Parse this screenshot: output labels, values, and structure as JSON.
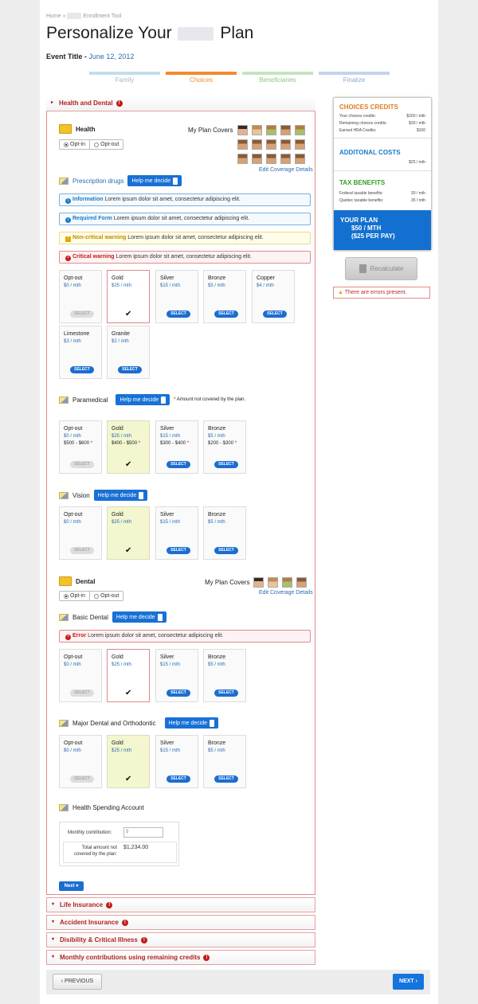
{
  "breadcrumb": {
    "home": "Home",
    "current": "Enrollment Tool"
  },
  "page_title": {
    "before": "Personalize Your",
    "after": "Plan"
  },
  "event": {
    "label": "Event Title",
    "date": "June 12, 2012"
  },
  "steps": [
    {
      "label": "Family",
      "color": "#c3ddec",
      "text": "#9cbac8"
    },
    {
      "label": "Choices",
      "color": "#f18b2f",
      "text": "#f18b2f"
    },
    {
      "label": "Beneficiaries",
      "color": "#c5e4c1",
      "text": "#8cc47f"
    },
    {
      "label": "Finalize",
      "color": "#c3d3ee",
      "text": "#8aa6d6"
    }
  ],
  "health_dental": {
    "title": "Health and Dental"
  },
  "health": {
    "title": "Health",
    "opt_in": "Opt-in",
    "opt_out": "Opt-out",
    "covers": "My Plan Covers",
    "edit_link": "Edit Coverage Details"
  },
  "help_label": "Help me decide",
  "select_label": "SELECT",
  "prescription": {
    "title": "Prescription drugs",
    "messages": [
      {
        "kind": "Information",
        "text": "Lorem ipsum dolor sit amet, consectetur adipiscing elit."
      },
      {
        "kind": "Required Form",
        "text": "Lorem ipsum dolor sit amet, consectetur adipiscing elit."
      },
      {
        "kind": "Non-critical warning",
        "text": "Lorem ipsum dolor sit amet, consectetur adipiscing elit."
      },
      {
        "kind": "Critical warning",
        "text": "Lorem ipsum dolor sit amet, consectetur adipiscing elit."
      }
    ],
    "options": [
      {
        "name": "Opt-out",
        "price": "$0 / mth"
      },
      {
        "name": "Gold",
        "price": "$25 / mth"
      },
      {
        "name": "Silver",
        "price": "$15 / mth"
      },
      {
        "name": "Bronze",
        "price": "$5 / mth"
      },
      {
        "name": "Copper",
        "price": "$4 / mth"
      },
      {
        "name": "Limestone",
        "price": "$3 / mth"
      },
      {
        "name": "Granite",
        "price": "$2 / mth"
      }
    ]
  },
  "paramedical": {
    "title": "Paramedical",
    "note": "Amount not covered by the plan.",
    "options": [
      {
        "name": "Opt-out",
        "price": "$0 / mth",
        "range": "$500 - $600"
      },
      {
        "name": "Gold",
        "price": "$25 / mth",
        "range": "$400 - $500"
      },
      {
        "name": "Silver",
        "price": "$15 / mth",
        "range": "$300 - $400"
      },
      {
        "name": "Bronze",
        "price": "$5 / mth",
        "range": "$200 - $300"
      }
    ]
  },
  "vision": {
    "title": "Vision",
    "options": [
      {
        "name": "Opt-out",
        "price": "$0 / mth"
      },
      {
        "name": "Gold",
        "price": "$25 / mth"
      },
      {
        "name": "Silver",
        "price": "$15 / mth"
      },
      {
        "name": "Bronze",
        "price": "$5 / mth"
      }
    ]
  },
  "dental": {
    "title": "Dental",
    "opt_in": "Opt-in",
    "opt_out": "Opt-out",
    "covers": "My Plan Covers",
    "edit_link": "Edit Coverage Details"
  },
  "basic_dental": {
    "title": "Basic Dental",
    "error_kind": "Error",
    "error_text": "Lorem ipsum dolor sit amet, consectetur adipiscing elit.",
    "options": [
      {
        "name": "Opt-out",
        "price": "$0 / mth"
      },
      {
        "name": "Gold",
        "price": "$25 / mth"
      },
      {
        "name": "Silver",
        "price": "$15 / mth"
      },
      {
        "name": "Bronze",
        "price": "$5 / mth"
      }
    ]
  },
  "major_dental": {
    "title": "Major Dental and Orthodontic",
    "options": [
      {
        "name": "Opt-out",
        "price": "$0 / mth"
      },
      {
        "name": "Gold",
        "price": "$25 / mth"
      },
      {
        "name": "Silver",
        "price": "$15 / mth"
      },
      {
        "name": "Bronze",
        "price": "$5 / mth"
      }
    ]
  },
  "hsa": {
    "title": "Health Spending Account",
    "contribution_label": "Monthly contribution:",
    "currency": "$",
    "total_label": "Total amount not covered by the plan:",
    "total_value": "$1,234.00"
  },
  "next_small": "Next",
  "collapsed": [
    "Life Insurance",
    "Accident Insurance",
    "Disibility & Critical Illness",
    "Monthly contributions using remaining credits"
  ],
  "sidebar": {
    "credits": {
      "title": "CHOICES CREDITS",
      "rows": [
        [
          "Your choices credits:",
          "$200 / mth"
        ],
        [
          "Remaining choices credits:",
          "$30 / mth"
        ],
        [
          "Earned HRA Credits:",
          "$100"
        ]
      ]
    },
    "costs": {
      "title": "ADDITONAL COSTS",
      "value": "$25 / mth"
    },
    "tax": {
      "title": "TAX BENEFITS",
      "rows": [
        [
          "Federal taxable benefits:",
          "30 / mth"
        ],
        [
          "Quebec taxable benefits:",
          "35 / mth"
        ]
      ]
    },
    "plan": {
      "title": "YOUR PLAN",
      "line1": "$50 / MTH",
      "line2": "($25 PER PAY)"
    },
    "recalc": "Recalculate",
    "error": "There are errors present."
  },
  "nav": {
    "previous": "PREVIOUS",
    "next": "NEXT"
  },
  "colors": {
    "accent": "#1a6ed2",
    "error": "#c61a1a",
    "orange": "#e07c20",
    "green": "#3a9a2a"
  }
}
